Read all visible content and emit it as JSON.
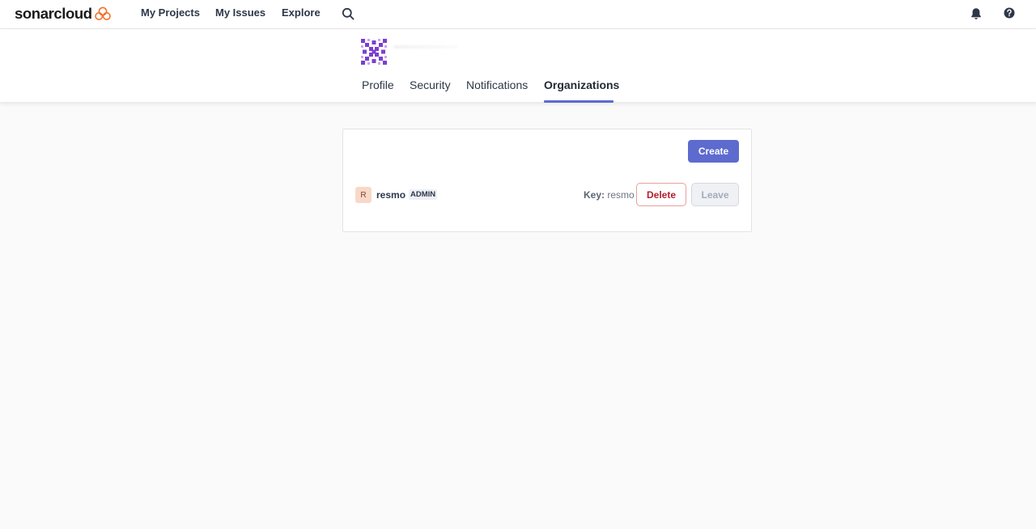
{
  "app": {
    "logo_text": "sonarcloud",
    "logo_icon": "sonarcloud-cloud-logo",
    "brand_color": "#f3702a"
  },
  "topnav": {
    "links": [
      {
        "label": "My Projects"
      },
      {
        "label": "My Issues"
      },
      {
        "label": "Explore"
      }
    ],
    "search_icon": "search-icon",
    "notifications_icon": "bell-icon",
    "help_icon": "help-icon"
  },
  "profile": {
    "avatar_icon": "identicon-avatar",
    "tabs": [
      {
        "label": "Profile",
        "active": false
      },
      {
        "label": "Security",
        "active": false
      },
      {
        "label": "Notifications",
        "active": false
      },
      {
        "label": "Organizations",
        "active": true
      }
    ],
    "accent_color": "#5d6bcf"
  },
  "organizations": {
    "create_label": "Create",
    "items": [
      {
        "avatar_letter": "R",
        "name": "resmo",
        "badge": "ADMIN",
        "key_label": "Key:",
        "key_value": "resmo",
        "delete_label": "Delete",
        "leave_label": "Leave",
        "leave_disabled": true
      }
    ]
  }
}
